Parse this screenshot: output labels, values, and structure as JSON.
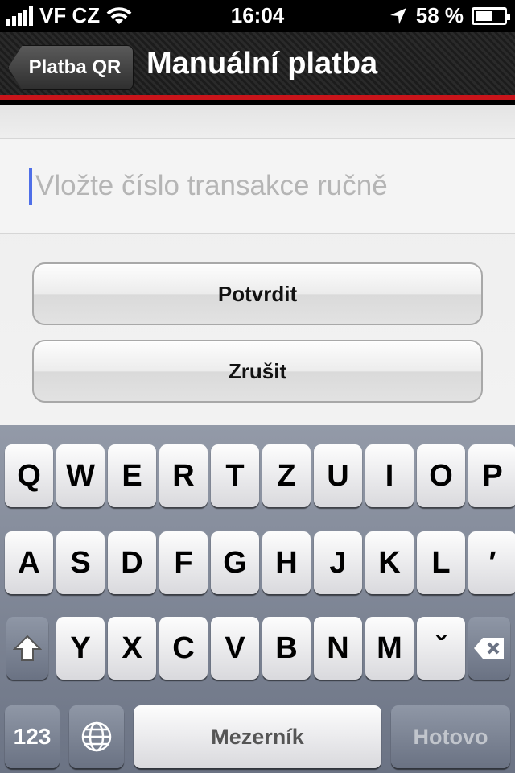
{
  "status_bar": {
    "carrier": "VF CZ",
    "time": "16:04",
    "battery_percent": "58 %",
    "battery_level": 0.58,
    "icons": [
      "signal-bars-icon",
      "wifi-icon",
      "location-arrow-icon",
      "battery-icon"
    ]
  },
  "nav": {
    "back_label": "Platba QR",
    "title": "Manuální platba",
    "accent_color": "#c9141a"
  },
  "form": {
    "placeholder": "Vložte číslo transakce ručně",
    "confirm_label": "Potvrdit",
    "cancel_label": "Zrušit"
  },
  "keyboard": {
    "row1": [
      "Q",
      "W",
      "E",
      "R",
      "T",
      "Z",
      "U",
      "I",
      "O",
      "P"
    ],
    "row2": [
      "A",
      "S",
      "D",
      "F",
      "G",
      "H",
      "J",
      "K",
      "L",
      "′"
    ],
    "row3": [
      "Y",
      "X",
      "C",
      "V",
      "B",
      "N",
      "M",
      "ˇ"
    ],
    "numbers_label": "123",
    "space_label": "Mezerník",
    "done_label": "Hotovo",
    "icons": [
      "shift-icon",
      "backspace-icon",
      "globe-icon"
    ]
  }
}
